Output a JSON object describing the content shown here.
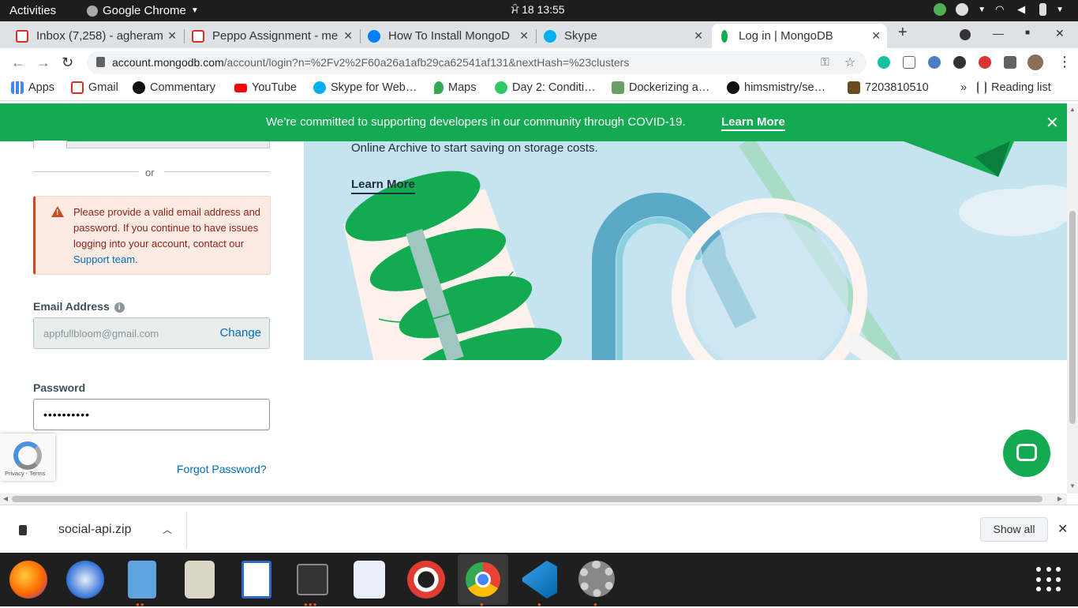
{
  "system_bar": {
    "activities": "Activities",
    "app_name": "Google Chrome",
    "clock": "ਮੰ 18  13:55"
  },
  "tabs": [
    {
      "title": "Inbox (7,258) - agheram",
      "icon": "gmail-icon"
    },
    {
      "title": "Peppo Assignment - me",
      "icon": "gmail-icon"
    },
    {
      "title": "How To Install MongoD",
      "icon": "digitalocean-icon"
    },
    {
      "title": "Skype",
      "icon": "skype-icon"
    },
    {
      "title": "Log in | MongoDB",
      "icon": "mongodb-leaf-icon",
      "active": true
    }
  ],
  "address_bar": {
    "host": "account.mongodb.com",
    "path": "/account/login?n=%2Fv2%2F60a26a1afb29ca62541af131&nextHash=%23clusters"
  },
  "bookmarks": [
    {
      "label": "Apps",
      "icon": "apps-grid-icon"
    },
    {
      "label": "Gmail",
      "icon": "gmail-icon"
    },
    {
      "label": "Commentary",
      "icon": "cricbuzz-icon"
    },
    {
      "label": "YouTube",
      "icon": "youtube-icon"
    },
    {
      "label": "Skype for Web…",
      "icon": "skype-icon"
    },
    {
      "label": "Maps",
      "icon": "maps-pin-icon"
    },
    {
      "label": "Day 2: Conditi…",
      "icon": "hackerrank-icon"
    },
    {
      "label": "Dockerizing a…",
      "icon": "node-icon"
    },
    {
      "label": "himsmistry/se…",
      "icon": "github-icon"
    },
    {
      "label": "7203810510",
      "icon": "bookmark-icon"
    }
  ],
  "reading_list": "Reading list",
  "covid_banner": {
    "message": "We’re committed to supporting developers in our community through COVID-19.",
    "link": "Learn More"
  },
  "hero": {
    "text": "Online Archive to start saving on storage costs.",
    "link": "Learn More",
    "arrow": "→"
  },
  "login": {
    "divider_text": "or",
    "alert_text": "Please provide a valid email address and password. If you continue to have issues logging into your account, contact our ",
    "alert_link": "Support team",
    "alert_end": ".",
    "email_label": "Email Address",
    "email_value": "appfullbloom@gmail.com",
    "change_label": "Change",
    "password_label": "Password",
    "password_mask": "••••••••••",
    "forgot_label": "Forgot Password?"
  },
  "recaptcha": {
    "terms": "Privacy - Terms"
  },
  "downloads": {
    "file": "social-api.zip",
    "show_all": "Show all"
  },
  "colors": {
    "mongodb_green": "#13aa52",
    "alert_red": "#cf4a22",
    "link_blue": "#006cbc"
  }
}
